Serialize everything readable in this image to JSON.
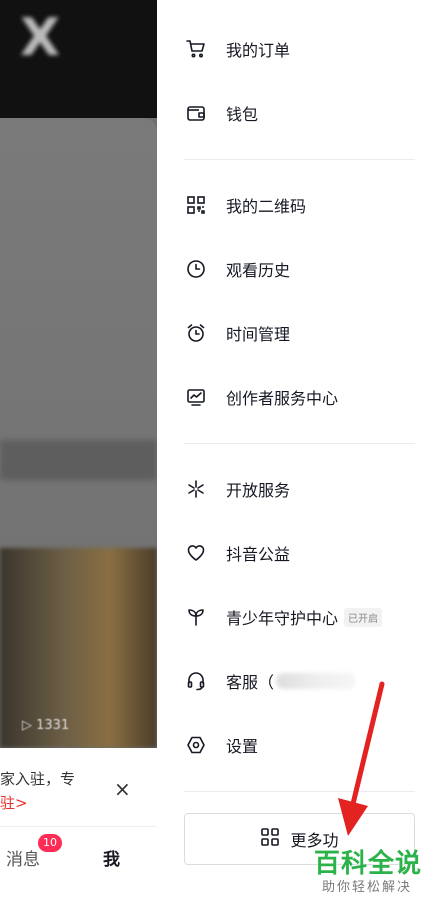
{
  "background": {
    "view_count": "1331",
    "banner_line1": "家入驻，专",
    "banner_line2": "驻>",
    "close_glyph": "×",
    "nav_messages": "消息",
    "nav_badge": "10",
    "nav_me": "我"
  },
  "drawer": {
    "items": [
      {
        "label": "我的订单",
        "icon": "cart-icon"
      },
      {
        "label": "钱包",
        "icon": "wallet-icon"
      },
      {
        "label": "我的二维码",
        "icon": "qrcode-icon"
      },
      {
        "label": "观看历史",
        "icon": "clock-icon"
      },
      {
        "label": "时间管理",
        "icon": "alarm-icon"
      },
      {
        "label": "创作者服务中心",
        "icon": "creator-chart-icon"
      },
      {
        "label": "开放服务",
        "icon": "spark-icon"
      },
      {
        "label": "抖音公益",
        "icon": "heart-icon"
      },
      {
        "label": "青少年守护中心",
        "icon": "sprout-icon",
        "tag": "已开启"
      },
      {
        "label": "客服（",
        "icon": "headset-icon"
      },
      {
        "label": "设置",
        "icon": "hexagon-icon"
      }
    ],
    "more_button": "更多功"
  },
  "watermark": {
    "main": "百科全说",
    "sub": "助你轻松解决"
  },
  "colors": {
    "accent_red": "#e8332e",
    "badge": "#fe2c55",
    "watermark_green": "#2bb34a"
  }
}
